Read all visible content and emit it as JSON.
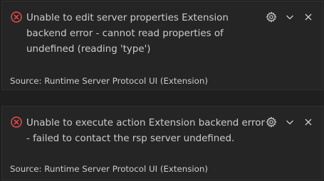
{
  "notifications": [
    {
      "severity": "error",
      "icon": "error-circle-icon",
      "message": "Unable to edit server properties Extension backend error - cannot read properties of undefined (reading 'type')",
      "source": "Source: Runtime Server Protocol UI (Extension)",
      "actions": [
        "gear-icon",
        "chevron-down-icon",
        "close-icon"
      ]
    },
    {
      "severity": "error",
      "icon": "error-circle-icon",
      "message": "Unable to execute action Extension backend error - failed to contact the rsp server undefined.",
      "source": "Source: Runtime Server Protocol UI (Extension)",
      "actions": [
        "gear-icon",
        "chevron-down-icon",
        "close-icon"
      ]
    }
  ],
  "colors": {
    "background": "#1f1f1f",
    "toast_background": "#252526",
    "text": "#cccccc",
    "error": "#f14c4c"
  }
}
